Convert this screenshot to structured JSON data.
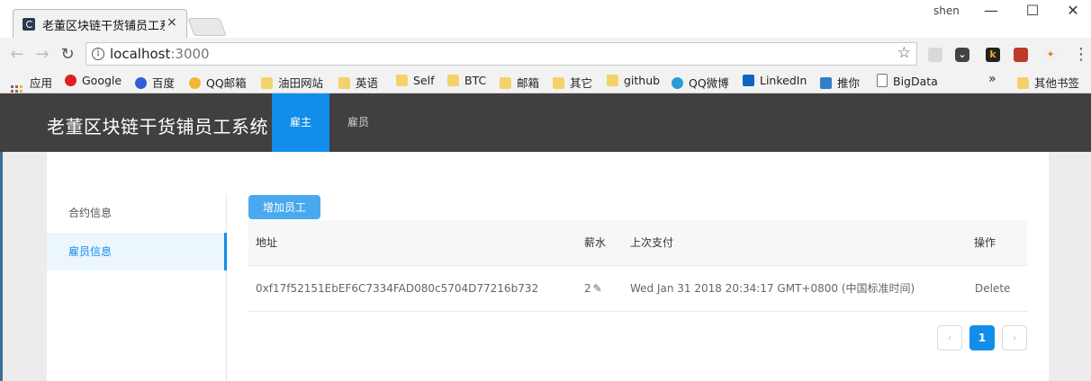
{
  "browser": {
    "tab_title": "老董区块链干货铺员工系统",
    "tab_close": "×",
    "user": "shen",
    "minimize": "—",
    "maximize": "☐",
    "close": "✕",
    "url_host": "localhost",
    "url_port": ":3000",
    "bookmark_star": "☆",
    "bookmarks": [
      {
        "label": "应用",
        "icon": "apps-icon"
      },
      {
        "label": "Google",
        "icon": "google-icon"
      },
      {
        "label": "百度",
        "icon": "baidu-icon"
      },
      {
        "label": "QQ邮箱",
        "icon": "qqmail-icon"
      },
      {
        "label": "油田网站",
        "icon": "folder-icon"
      },
      {
        "label": "英语",
        "icon": "folder-icon"
      },
      {
        "label": "Self",
        "icon": "folder-icon"
      },
      {
        "label": "BTC",
        "icon": "folder-icon"
      },
      {
        "label": "邮箱",
        "icon": "folder-icon"
      },
      {
        "label": "其它",
        "icon": "folder-icon"
      },
      {
        "label": "github",
        "icon": "folder-icon"
      },
      {
        "label": "QQ微博",
        "icon": "qqweibo-icon"
      },
      {
        "label": "LinkedIn",
        "icon": "linkedin-icon"
      },
      {
        "label": "推你",
        "icon": "tuini-icon"
      },
      {
        "label": "BigData",
        "icon": "page-icon"
      }
    ],
    "bookmarks_overflow": "»",
    "other_bookmarks": "其他书签"
  },
  "app": {
    "title": "老董区块链干货铺员工系统",
    "tabs": [
      "雇主",
      "雇员"
    ],
    "active_tab": "雇主",
    "side_menu": [
      "合约信息",
      "雇员信息"
    ],
    "selected_menu": "雇员信息",
    "add_button": "增加员工",
    "table": {
      "columns": [
        "地址",
        "薪水",
        "上次支付",
        "操作"
      ],
      "rows": [
        {
          "address": "0xf17f52151EbEF6C7334FAD080c5704D77216b732",
          "salary": "2",
          "last_paid": "Wed Jan 31 2018 20:34:17 GMT+0800 (中国标准时间)",
          "action": "Delete"
        }
      ]
    },
    "pagination": {
      "prev": "‹",
      "current": "1",
      "next": "›"
    }
  },
  "colors": {
    "header_bg": "#404040",
    "primary": "#108ee9",
    "button": "#49a9ee"
  }
}
